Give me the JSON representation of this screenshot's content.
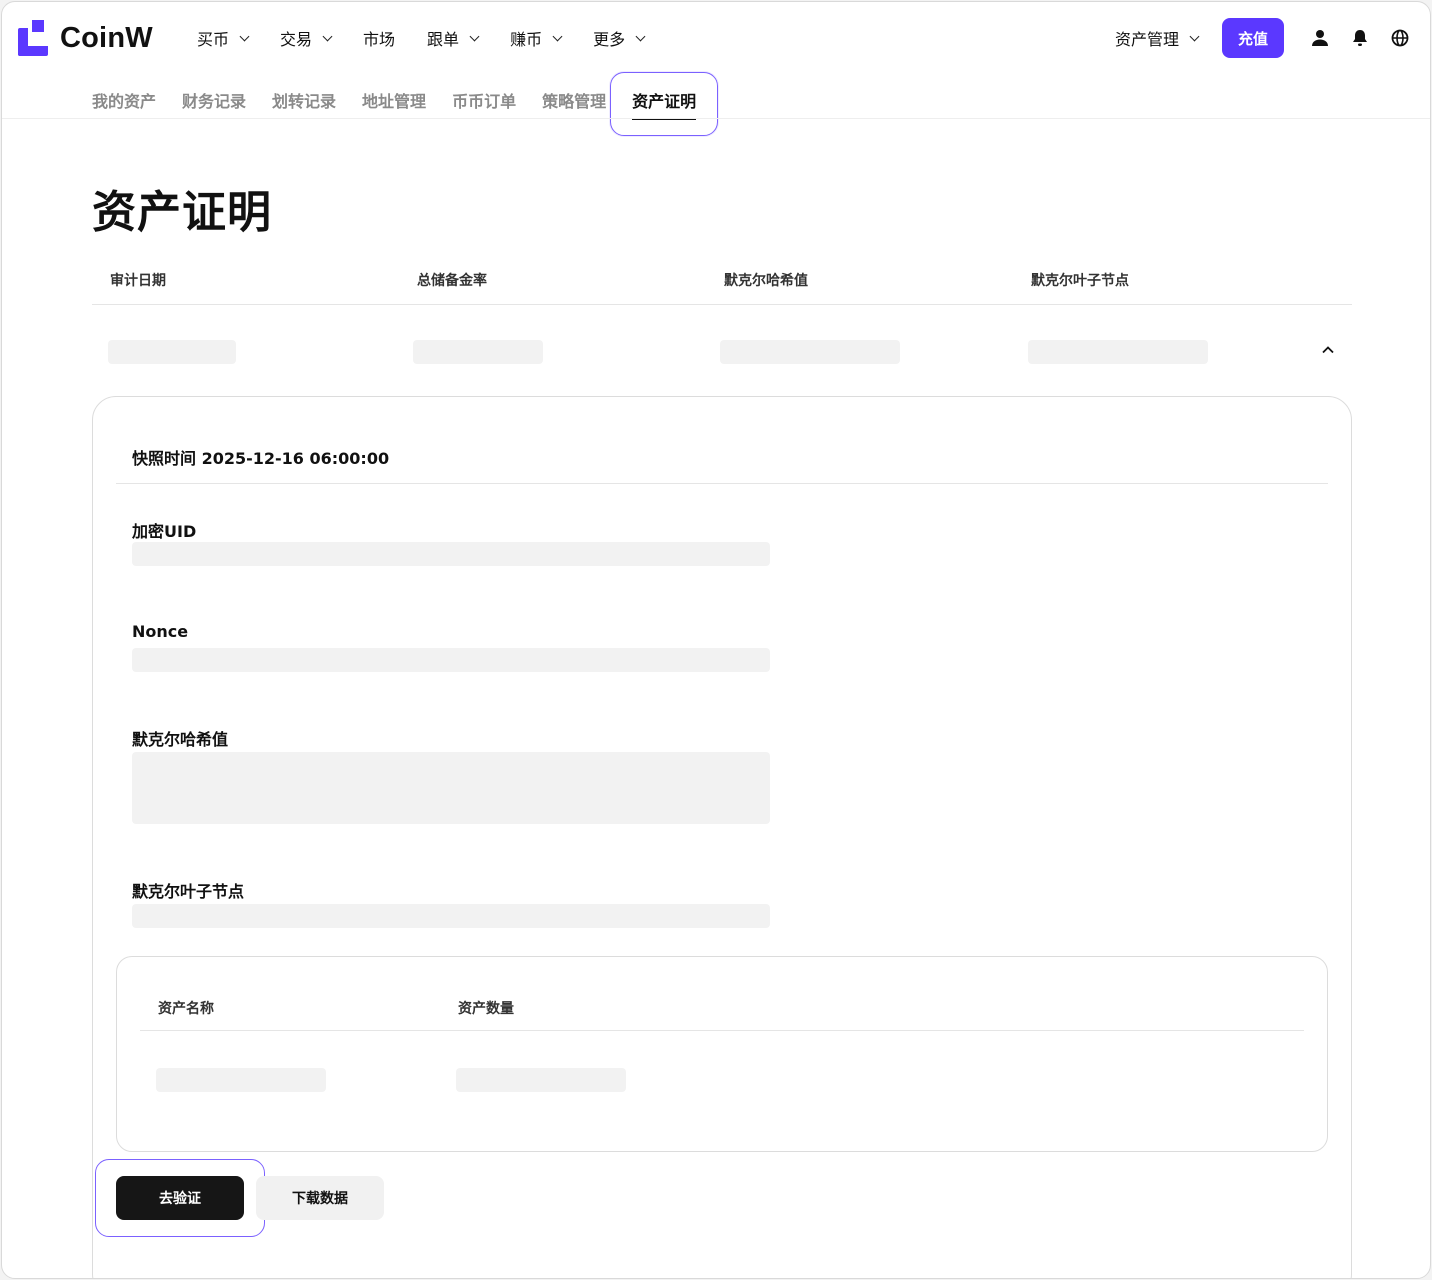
{
  "header": {
    "logo_text": "CoinW",
    "nav": [
      {
        "label": "买币",
        "dropdown": true
      },
      {
        "label": "交易",
        "dropdown": true
      },
      {
        "label": "市场",
        "dropdown": false
      },
      {
        "label": "跟单",
        "dropdown": true
      },
      {
        "label": "赚币",
        "dropdown": true
      },
      {
        "label": "更多",
        "dropdown": true
      }
    ],
    "asset_mgmt_label": "资产管理",
    "deposit_label": "充值",
    "icons": [
      "user-icon",
      "bell-icon",
      "globe-icon"
    ],
    "brand_color": "#5b38ff"
  },
  "subnav": {
    "tabs": [
      "我的资产",
      "财务记录",
      "划转记录",
      "地址管理",
      "币币订单",
      "策略管理",
      "资产证明"
    ],
    "active": "资产证明"
  },
  "page": {
    "title": "资产证明",
    "summary_columns": [
      "审计日期",
      "总储备金率",
      "默克尔哈希值",
      "默克尔叶子节点"
    ],
    "snapshot_text": "快照时间 2025-12-16 06:00:00",
    "fields": [
      "加密UID",
      "Nonce",
      "默克尔哈希值",
      "默克尔叶子节点"
    ],
    "asset_columns": [
      "资产名称",
      "资产数量"
    ],
    "verify_label": "去验证",
    "download_label": "下载数据"
  }
}
